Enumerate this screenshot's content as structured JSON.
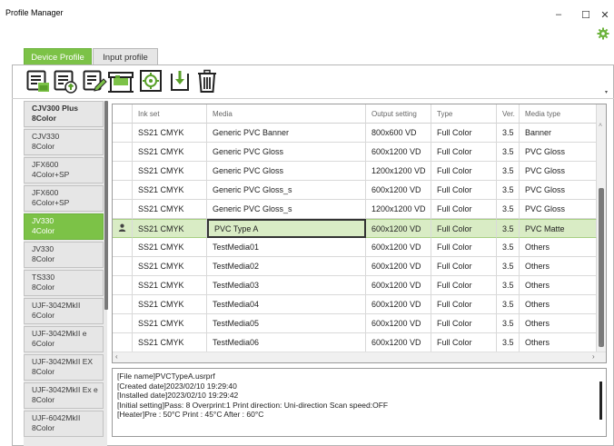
{
  "window": {
    "title": "Profile Manager",
    "minimize": "–",
    "maximize": "☐",
    "close": "✕"
  },
  "tabs": [
    {
      "label": "Device Profile",
      "active": true
    },
    {
      "label": "Input profile",
      "active": false
    }
  ],
  "toolbar": {
    "icons": [
      "open-list-icon",
      "upload-list-icon",
      "edit-list-icon",
      "printer-icon",
      "target-icon",
      "download-icon",
      "trash-icon"
    ]
  },
  "devices": [
    {
      "line1": "CJV300 Plus",
      "line2": "8Color",
      "selected": false
    },
    {
      "line1": "CJV330",
      "line2": "8Color",
      "selected": false
    },
    {
      "line1": "JFX600",
      "line2": "4Color+SP",
      "selected": false
    },
    {
      "line1": "JFX600",
      "line2": "6Color+SP",
      "selected": false
    },
    {
      "line1": "JV330",
      "line2": "4Color",
      "selected": true
    },
    {
      "line1": "JV330",
      "line2": "8Color",
      "selected": false
    },
    {
      "line1": "TS330",
      "line2": "8Color",
      "selected": false
    },
    {
      "line1": "UJF-3042MkII",
      "line2": "6Color",
      "selected": false
    },
    {
      "line1": "UJF-3042MkII e",
      "line2": "6Color",
      "selected": false
    },
    {
      "line1": "UJF-3042MkII EX",
      "line2": "8Color",
      "selected": false
    },
    {
      "line1": "UJF-3042MkII Ex e",
      "line2": "8Color",
      "selected": false
    },
    {
      "line1": "UJF-6042MkII",
      "line2": "8Color",
      "selected": false
    }
  ],
  "table": {
    "columns": [
      "",
      "Ink set",
      "Media",
      "Output setting",
      "Type",
      "Ver.",
      "Media type"
    ],
    "rows": [
      {
        "ink": "SS21 CMYK",
        "media": "Generic PVC Banner",
        "output": "800x600 VD",
        "type": "Full Color",
        "ver": "3.5",
        "mtype": "Banner",
        "selected": false
      },
      {
        "ink": "SS21 CMYK",
        "media": "Generic PVC Gloss",
        "output": "600x1200 VD",
        "type": "Full Color",
        "ver": "3.5",
        "mtype": "PVC Gloss",
        "selected": false
      },
      {
        "ink": "SS21 CMYK",
        "media": "Generic PVC Gloss",
        "output": "1200x1200 VD",
        "type": "Full Color",
        "ver": "3.5",
        "mtype": "PVC Gloss",
        "selected": false
      },
      {
        "ink": "SS21 CMYK",
        "media": "Generic PVC Gloss_s",
        "output": "600x1200 VD",
        "type": "Full Color",
        "ver": "3.5",
        "mtype": "PVC Gloss",
        "selected": false
      },
      {
        "ink": "SS21 CMYK",
        "media": "Generic PVC Gloss_s",
        "output": "1200x1200 VD",
        "type": "Full Color",
        "ver": "3.5",
        "mtype": "PVC Gloss",
        "selected": false
      },
      {
        "ink": "SS21 CMYK",
        "media": "PVC Type A",
        "output": "600x1200 VD",
        "type": "Full Color",
        "ver": "3.5",
        "mtype": "PVC Matte",
        "selected": true
      },
      {
        "ink": "SS21 CMYK",
        "media": "TestMedia01",
        "output": "600x1200 VD",
        "type": "Full Color",
        "ver": "3.5",
        "mtype": "Others",
        "selected": false
      },
      {
        "ink": "SS21 CMYK",
        "media": "TestMedia02",
        "output": "600x1200 VD",
        "type": "Full Color",
        "ver": "3.5",
        "mtype": "Others",
        "selected": false
      },
      {
        "ink": "SS21 CMYK",
        "media": "TestMedia03",
        "output": "600x1200 VD",
        "type": "Full Color",
        "ver": "3.5",
        "mtype": "Others",
        "selected": false
      },
      {
        "ink": "SS21 CMYK",
        "media": "TestMedia04",
        "output": "600x1200 VD",
        "type": "Full Color",
        "ver": "3.5",
        "mtype": "Others",
        "selected": false
      },
      {
        "ink": "SS21 CMYK",
        "media": "TestMedia05",
        "output": "600x1200 VD",
        "type": "Full Color",
        "ver": "3.5",
        "mtype": "Others",
        "selected": false
      },
      {
        "ink": "SS21 CMYK",
        "media": "TestMedia06",
        "output": "600x1200 VD",
        "type": "Full Color",
        "ver": "3.5",
        "mtype": "Others",
        "selected": false
      }
    ]
  },
  "info": {
    "lines": [
      "[File name]PVCTypeA.usrprf",
      "[Created date]2023/02/10 19:29:40",
      "[Installed date]2023/02/10 19:29:42",
      "[Initial setting]Pass: 8 Overprint:1 Print direction: Uni-direction Scan speed:OFF",
      "[Heater]Pre : 50°C Print : 45°C After : 60°C"
    ]
  },
  "colors": {
    "accent": "#7cc247",
    "selected_row": "#d9ecc5",
    "settings_gear": "#6cb33c"
  }
}
